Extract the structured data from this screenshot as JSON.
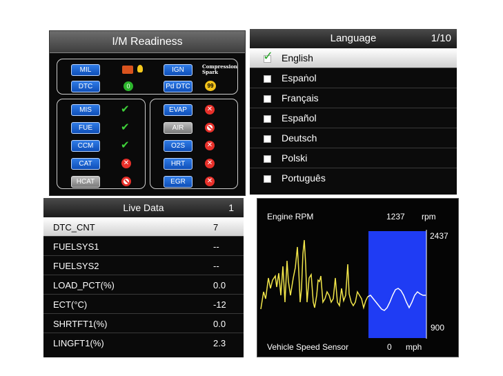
{
  "im_readiness": {
    "title": "I/M Readiness",
    "top_items": [
      {
        "label": "MIL",
        "status_icon": "engine-warning-icon"
      },
      {
        "label": "IGN",
        "status_text": "Compression Spark"
      },
      {
        "label": "DTC",
        "status_value": "0"
      },
      {
        "label": "Pd DTC",
        "status_value": "99"
      }
    ],
    "monitors_left": [
      {
        "label": "MIS",
        "status": "check",
        "enabled": true
      },
      {
        "label": "FUE",
        "status": "check",
        "enabled": true
      },
      {
        "label": "CCM",
        "status": "check",
        "enabled": true
      },
      {
        "label": "CAT",
        "status": "x",
        "enabled": true
      },
      {
        "label": "HCAT",
        "status": "not-supported",
        "enabled": false
      }
    ],
    "monitors_right": [
      {
        "label": "EVAP",
        "status": "x",
        "enabled": true
      },
      {
        "label": "AIR",
        "status": "not-supported",
        "enabled": false
      },
      {
        "label": "O2S",
        "status": "x",
        "enabled": true
      },
      {
        "label": "HRT",
        "status": "x",
        "enabled": true
      },
      {
        "label": "EGR",
        "status": "x",
        "enabled": true
      }
    ],
    "ign_text_line1": "Compression",
    "ign_text_line2": "Spark"
  },
  "language": {
    "title": "Language",
    "page": "1/10",
    "items": [
      "English",
      "Espaṅol",
      "Français",
      "Español",
      "Deutsch",
      "Polski",
      "Português"
    ],
    "selected_index": 0
  },
  "live_data": {
    "title": "Live Data",
    "page": "1",
    "rows": [
      {
        "key": "DTC_CNT",
        "value": "7"
      },
      {
        "key": "FUELSYS1",
        "value": "--"
      },
      {
        "key": "FUELSYS2",
        "value": "--"
      },
      {
        "key": "LOAD_PCT(%)",
        "value": "0.0"
      },
      {
        "key": "ECT(°C)",
        "value": "-12"
      },
      {
        "key": "SHRTFT1(%)",
        "value": "0.0"
      },
      {
        "key": "LINGFT1(%)",
        "value": "2.3"
      }
    ],
    "selected_index": 0
  },
  "graph": {
    "pid_name": "Engine RPM",
    "pid_value": "1237",
    "pid_unit": "rpm",
    "y_max": "2437",
    "y_min": "900",
    "footer_name": "Vehicle Speed Sensor",
    "footer_value": "0",
    "footer_unit": "mph",
    "colors": {
      "trace_before": "#f2e64a",
      "trace_after": "#ffffff",
      "highlight": "#1f3cf4"
    }
  }
}
